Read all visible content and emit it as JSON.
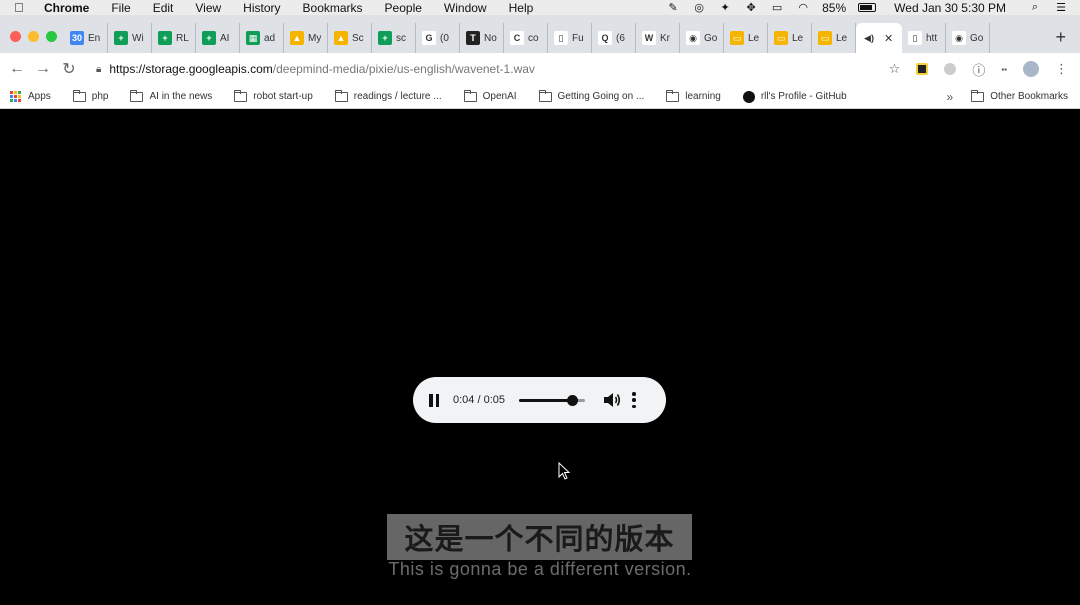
{
  "menubar": {
    "app": "Chrome",
    "items": [
      "File",
      "Edit",
      "View",
      "History",
      "Bookmarks",
      "People",
      "Window",
      "Help"
    ],
    "battery": "85%",
    "datetime": "Wed Jan 30  5:30 PM"
  },
  "tabs": [
    {
      "label": "En",
      "favicon_color": "#4285f4",
      "favicon_text": "30"
    },
    {
      "label": "Wi",
      "favicon_color": "#0f9d58",
      "favicon_text": "+"
    },
    {
      "label": "RL",
      "favicon_color": "#0f9d58",
      "favicon_text": "+"
    },
    {
      "label": "AI",
      "favicon_color": "#0f9d58",
      "favicon_text": "+"
    },
    {
      "label": "ad",
      "favicon_color": "#0f9d58",
      "favicon_text": "▦"
    },
    {
      "label": "My",
      "favicon_color": "#f4b400",
      "favicon_text": "▲"
    },
    {
      "label": "Sc",
      "favicon_color": "#f4b400",
      "favicon_text": "▲"
    },
    {
      "label": "sc",
      "favicon_color": "#0f9d58",
      "favicon_text": "+"
    },
    {
      "label": "(0",
      "favicon_color": "#ffffff",
      "favicon_text": "G"
    },
    {
      "label": "No",
      "favicon_color": "#222222",
      "favicon_text": "T"
    },
    {
      "label": "co",
      "favicon_color": "#ffffff",
      "favicon_text": "C"
    },
    {
      "label": "Fu",
      "favicon_color": "#ffffff",
      "favicon_text": "▯"
    },
    {
      "label": "(6",
      "favicon_color": "#ffffff",
      "favicon_text": "Q"
    },
    {
      "label": "Kr",
      "favicon_color": "#ffffff",
      "favicon_text": "W"
    },
    {
      "label": "Go",
      "favicon_color": "#ffffff",
      "favicon_text": "◉"
    },
    {
      "label": "Le",
      "favicon_color": "#f4b400",
      "favicon_text": "▭"
    },
    {
      "label": "Le",
      "favicon_color": "#f4b400",
      "favicon_text": "▭"
    },
    {
      "label": "Le",
      "favicon_color": "#f4b400",
      "favicon_text": "▭"
    },
    {
      "label": "",
      "favicon_color": "#ffffff",
      "favicon_text": "◀)",
      "active": true
    },
    {
      "label": "htt",
      "favicon_color": "#ffffff",
      "favicon_text": "▯"
    },
    {
      "label": "Go",
      "favicon_color": "#ffffff",
      "favicon_text": "◉"
    }
  ],
  "address": {
    "domain": "https://storage.googleapis.com",
    "path": "/deepmind-media/pixie/us-english/wavenet-1.wav"
  },
  "bookmarks": [
    {
      "label": "Apps",
      "kind": "apps"
    },
    {
      "label": "php",
      "kind": "folder"
    },
    {
      "label": "AI in the news",
      "kind": "folder"
    },
    {
      "label": "robot start-up",
      "kind": "folder"
    },
    {
      "label": "readings / lecture ...",
      "kind": "folder"
    },
    {
      "label": "OpenAI",
      "kind": "folder"
    },
    {
      "label": "Getting Going on ...",
      "kind": "folder"
    },
    {
      "label": "learning",
      "kind": "folder"
    },
    {
      "label": "rll's Profile - GitHub",
      "kind": "github"
    }
  ],
  "other_bookmarks": "Other Bookmarks",
  "player": {
    "time": "0:04 / 0:05",
    "progress": 0.8
  },
  "subtitles": {
    "chinese": "这是一个不同的版本",
    "english": "This is gonna be a different version."
  }
}
